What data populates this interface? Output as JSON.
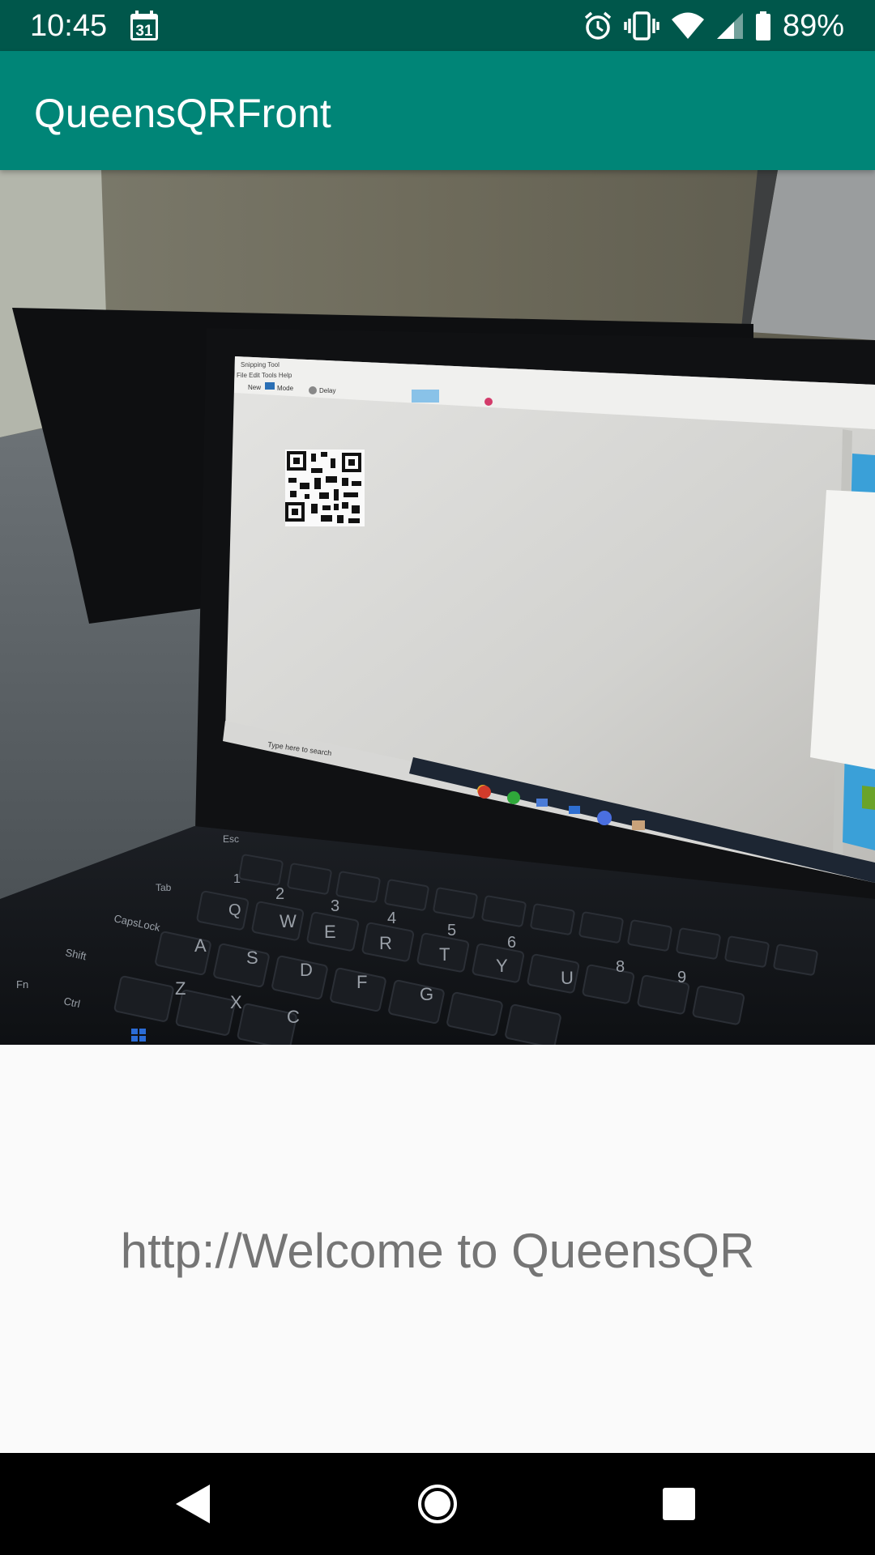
{
  "status_bar": {
    "time": "10:45",
    "calendar_day": "31",
    "battery_percent": "89%",
    "icons": [
      "calendar-icon",
      "alarm-icon",
      "vibrate-icon",
      "wifi-icon",
      "cell-signal-icon",
      "battery-icon"
    ]
  },
  "app_bar": {
    "title": "QueensQRFront",
    "color": "#008577"
  },
  "camera_preview": {
    "screen_texts": {
      "snipping_title": "Snipping Tool",
      "menu": "File  Edit  Tools  Help",
      "toolbar_new": "New",
      "toolbar_mode": "Mode",
      "toolbar_delay": "Delay",
      "taskbar_search": "Type here to search"
    },
    "keyboard_keys": {
      "esc": "Esc",
      "tab": "Tab",
      "capslock": "CapsLock",
      "shift": "Shift",
      "fn": "Fn",
      "ctrl": "Ctrl",
      "q": "Q",
      "w": "W",
      "e": "E",
      "r": "R",
      "t": "T",
      "y": "Y",
      "u": "U",
      "a": "A",
      "s": "S",
      "d": "D",
      "f": "F",
      "g": "G",
      "z": "Z",
      "x": "X",
      "c": "C",
      "n1": "1",
      "n2": "2",
      "n3": "3",
      "n4": "4",
      "n5": "5",
      "n6": "6",
      "n8": "8",
      "n9": "9"
    }
  },
  "result": {
    "text": "http://Welcome to QueensQR"
  },
  "nav_bar": {
    "back": "back-icon",
    "home": "home-icon",
    "recents": "recents-icon"
  }
}
